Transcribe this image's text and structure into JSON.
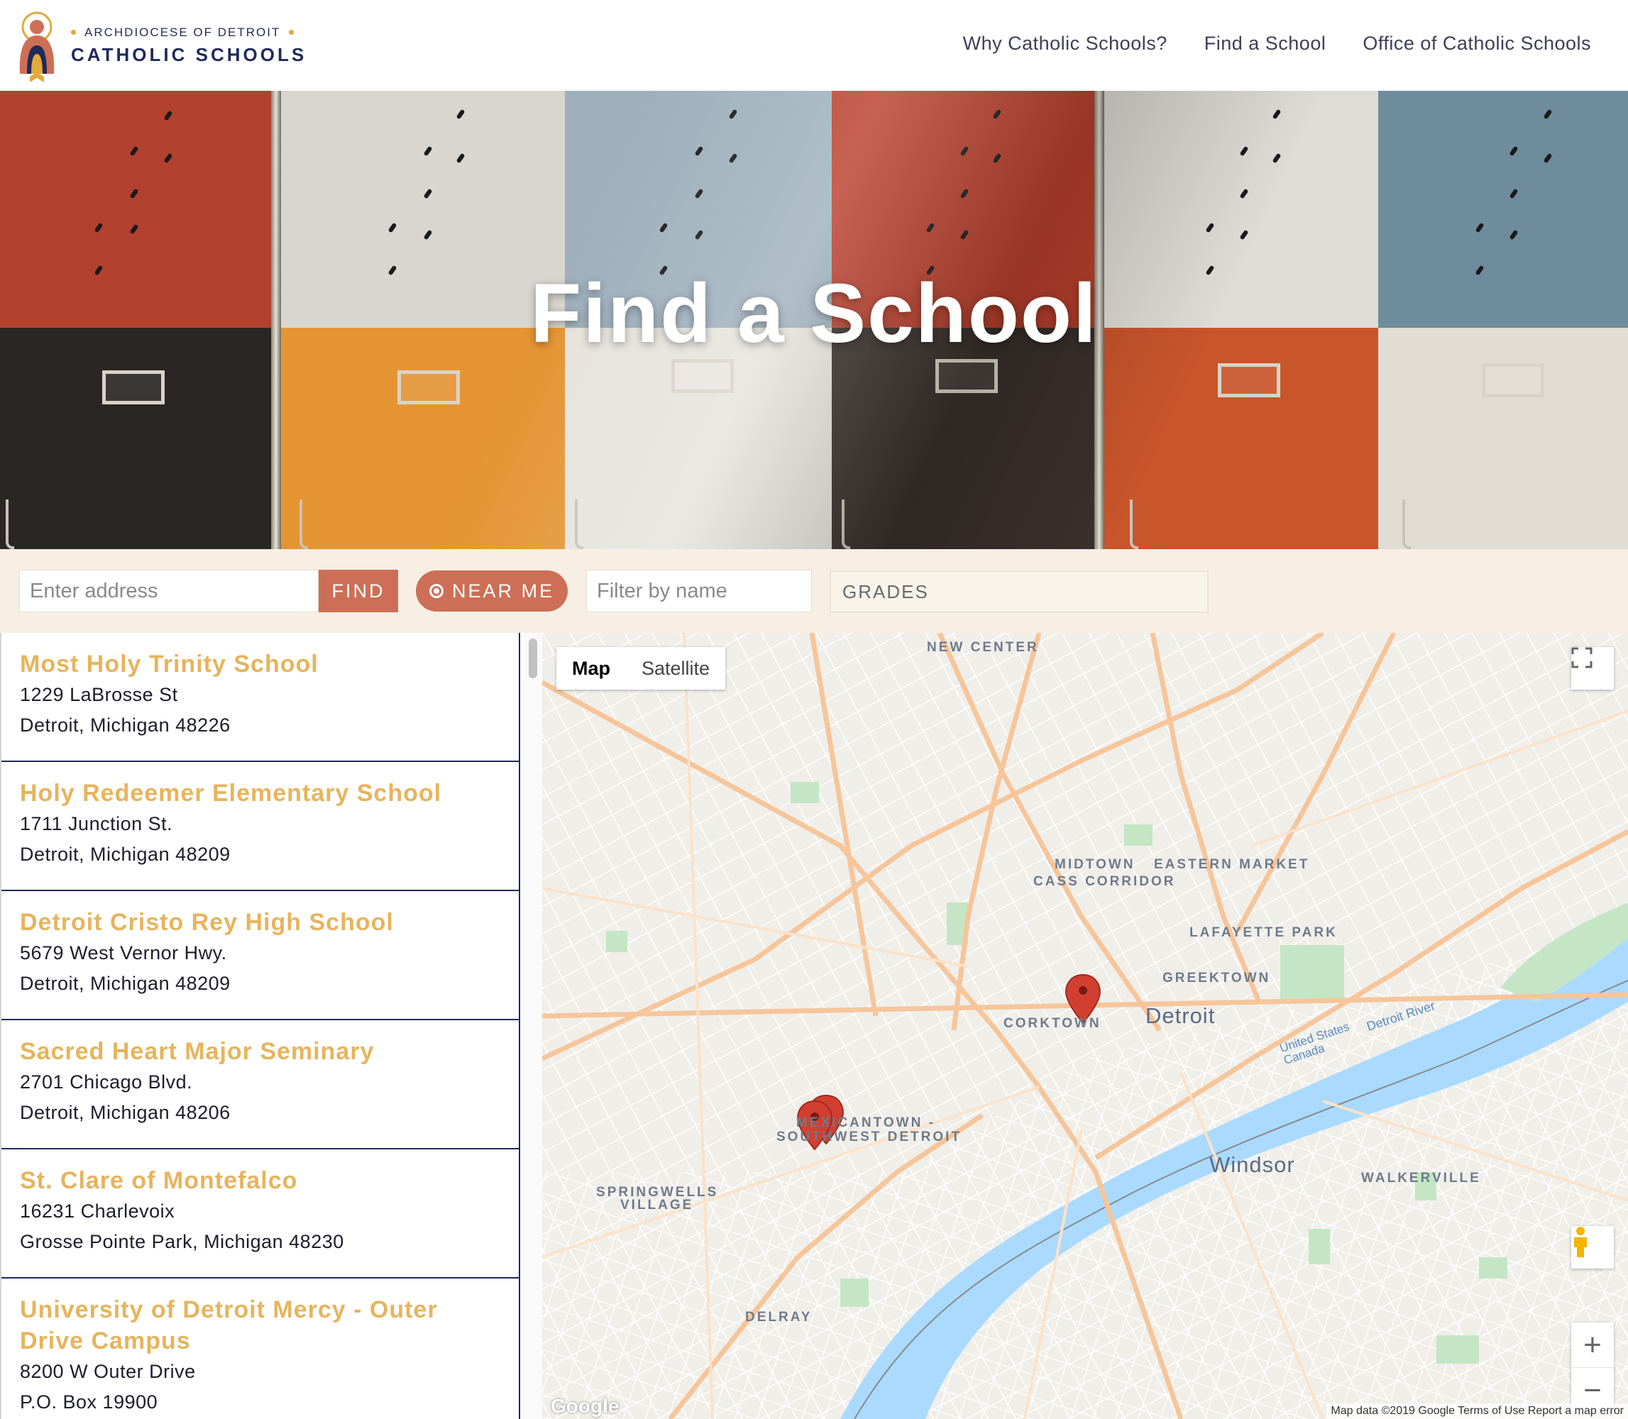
{
  "header": {
    "logo_line1": "ARCHDIOCESE OF DETROIT",
    "logo_line2": "CATHOLIC SCHOOLS",
    "nav": [
      {
        "label": "Why Catholic Schools?"
      },
      {
        "label": "Find a School"
      },
      {
        "label": "Office of Catholic Schools"
      }
    ]
  },
  "hero": {
    "title": "Find a School"
  },
  "search": {
    "address_placeholder": "Enter address",
    "find_label": "FIND",
    "near_me_label": "NEAR ME",
    "name_placeholder": "Filter by name",
    "grades_label": "GRADES"
  },
  "schools": [
    {
      "name": "Most Holy Trinity School",
      "line1": "1229 LaBrosse St",
      "line2": "Detroit, Michigan 48226"
    },
    {
      "name": "Holy Redeemer Elementary School",
      "line1": "1711 Junction St.",
      "line2": "Detroit, Michigan 48209"
    },
    {
      "name": "Detroit Cristo Rey High School",
      "line1": "5679 West Vernor Hwy.",
      "line2": "Detroit, Michigan 48209"
    },
    {
      "name": "Sacred Heart Major Seminary",
      "line1": "2701 Chicago Blvd.",
      "line2": "Detroit, Michigan 48206"
    },
    {
      "name": "St. Clare of Montefalco",
      "line1": "16231 Charlevoix",
      "line2": "Grosse Pointe Park, Michigan 48230"
    },
    {
      "name": "University of Detroit Mercy - Outer Drive Campus",
      "line1": "8200 W Outer Drive",
      "line2": "P.O. Box 19900"
    }
  ],
  "map": {
    "type_map": "Map",
    "type_satellite": "Satellite",
    "google": "Google",
    "footer": "Map data ©2019 Google  Terms of Use  Report a map error",
    "neighborhoods": {
      "new_center": "NEW CENTER",
      "midtown": "MIDTOWN",
      "cass_corridor": "CASS CORRIDOR",
      "eastern_market": "EASTERN MARKET",
      "lafayette_park": "LAFAYETTE PARK",
      "greektown": "GREEKTOWN",
      "corktown": "CORKTOWN",
      "mexicantown": "MEXICANTOWN -",
      "southwest": "SOUTHWEST DETROIT",
      "springwells": "SPRINGWELLS",
      "village": "VILLAGE",
      "delray": "DELRAY",
      "walkerville": "WALKERVILLE"
    },
    "cities": {
      "detroit": "Detroit",
      "windsor": "Windsor"
    },
    "river": "Detroit River",
    "border": "United States Canada"
  },
  "colors": {
    "accent": "#cd6f56",
    "school_name": "#e7b45c",
    "navy": "#1f2b5a",
    "search_bg": "#f7efe4",
    "water": "#aadaff",
    "pin": "#d23f31"
  }
}
